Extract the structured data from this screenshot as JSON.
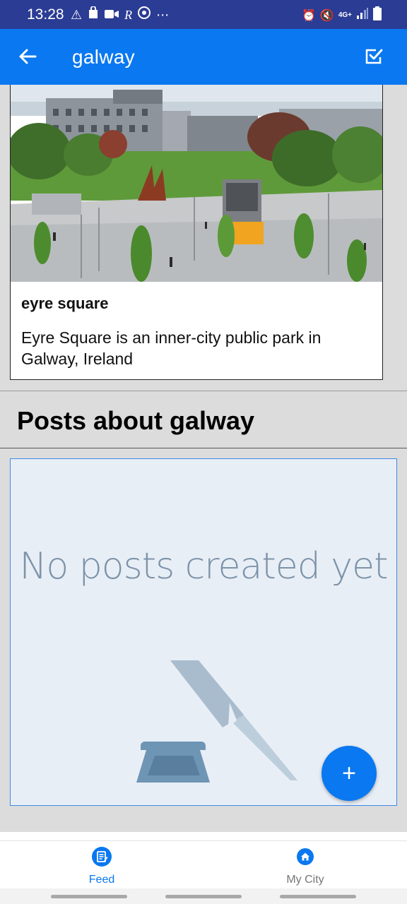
{
  "status_bar": {
    "time": "13:28",
    "left_icons": [
      "warning-icon",
      "bag-icon",
      "video-icon",
      "r-icon",
      "chrome-icon",
      "more-icon"
    ],
    "right_icons": [
      "alarm-icon",
      "mute-icon",
      "network-icon",
      "signal-icon",
      "battery-icon"
    ],
    "network_label": "4G+"
  },
  "app_bar": {
    "title": "galway",
    "back_icon": "arrow-left-icon",
    "action_icon": "checkbox-icon"
  },
  "place": {
    "name": "eyre square",
    "description": "Eyre Square is an inner-city public park in Galway, Ireland"
  },
  "posts_section": {
    "title": "Posts about galway",
    "empty_message": "No posts created yet",
    "fab_label": "+"
  },
  "bottom_nav": {
    "items": [
      {
        "label": "Feed",
        "icon": "feed-icon",
        "active": true
      },
      {
        "label": "My City",
        "icon": "home-icon",
        "active": false
      }
    ]
  },
  "colors": {
    "accent": "#0a78f0",
    "status_bar": "#2b3c94",
    "empty_panel": "#e8eef6"
  }
}
